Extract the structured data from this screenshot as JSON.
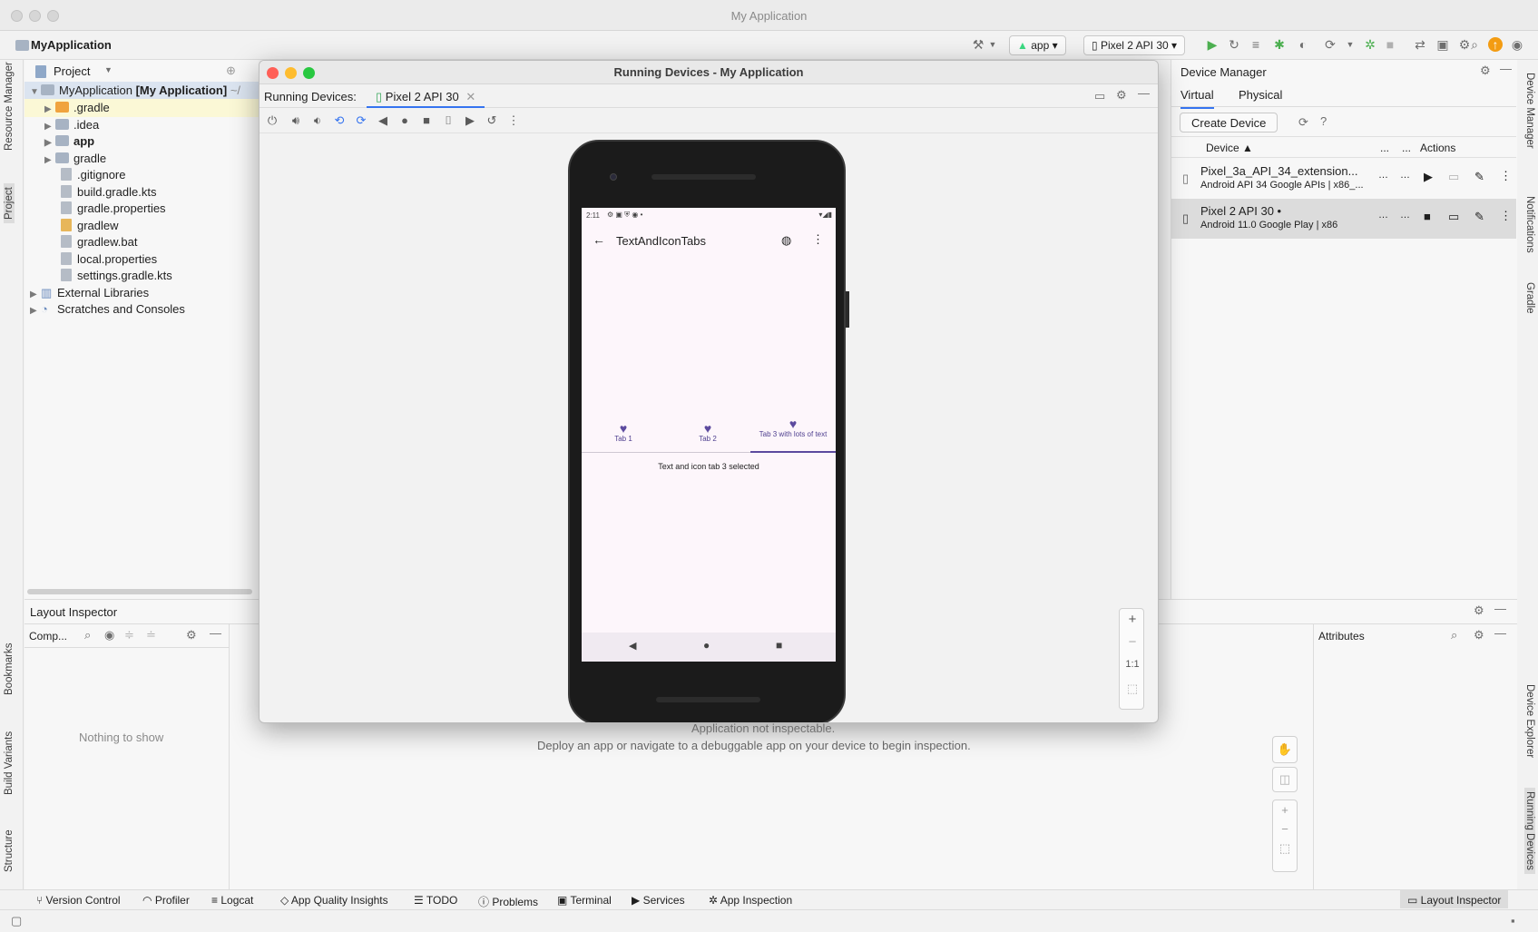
{
  "window": {
    "title": "My Application"
  },
  "toolbar": {
    "project_name": "MyApplication",
    "run_config": "app",
    "device_selector": "Pixel 2 API 30"
  },
  "left_strip": {
    "resource_manager": "Resource Manager",
    "project": "Project",
    "bookmarks": "Bookmarks",
    "build_variants": "Build Variants",
    "structure": "Structure"
  },
  "right_strip": {
    "device_manager": "Device Manager",
    "notifications": "Notifications",
    "gradle": "Gradle",
    "device_explorer": "Device Explorer",
    "running_devices": "Running Devices"
  },
  "project_panel": {
    "header": "Project",
    "root_name": "MyApplication",
    "root_module": "[My Application]",
    "root_path": "~/",
    "items": [
      ".gradle",
      ".idea",
      "app",
      "gradle",
      ".gitignore",
      "build.gradle.kts",
      "gradle.properties",
      "gradlew",
      "gradlew.bat",
      "local.properties",
      "settings.gradle.kts"
    ],
    "external": "External Libraries",
    "scratches": "Scratches and Consoles"
  },
  "device_manager": {
    "title": "Device Manager",
    "tabs": [
      "Virtual",
      "Physical"
    ],
    "create_button": "Create Device",
    "columns": {
      "device": "Device",
      "dots1": "...",
      "dots2": "...",
      "actions": "Actions"
    },
    "devices": [
      {
        "name": "Pixel_3a_API_34_extension...",
        "detail": "Android API 34 Google APIs | x86_..."
      },
      {
        "name": "Pixel 2 API 30 •",
        "detail": "Android 11.0 Google Play | x86"
      }
    ]
  },
  "layout_inspector": {
    "title": "Layout Inspector",
    "components": "Comp...",
    "nothing": "Nothing to show",
    "attributes": "Attributes",
    "not_inspectable": "Application not inspectable.",
    "deploy_hint": "Deploy an app or navigate to a debuggable app on your device to begin inspection."
  },
  "running_devices": {
    "title": "Running Devices - My Application",
    "label": "Running Devices:",
    "tab": "Pixel 2 API 30",
    "zoom_ratio": "1:1"
  },
  "phone": {
    "time": "2:11",
    "app_title": "TextAndIconTabs",
    "tabs": [
      "Tab 1",
      "Tab 2",
      "Tab 3 with lots of text"
    ],
    "selected_text": "Text and icon tab 3 selected"
  },
  "bottom_tools": [
    "Version Control",
    "Profiler",
    "Logcat",
    "App Quality Insights",
    "TODO",
    "Problems",
    "Terminal",
    "Services",
    "App Inspection"
  ],
  "bottom_right_tool": "Layout Inspector"
}
